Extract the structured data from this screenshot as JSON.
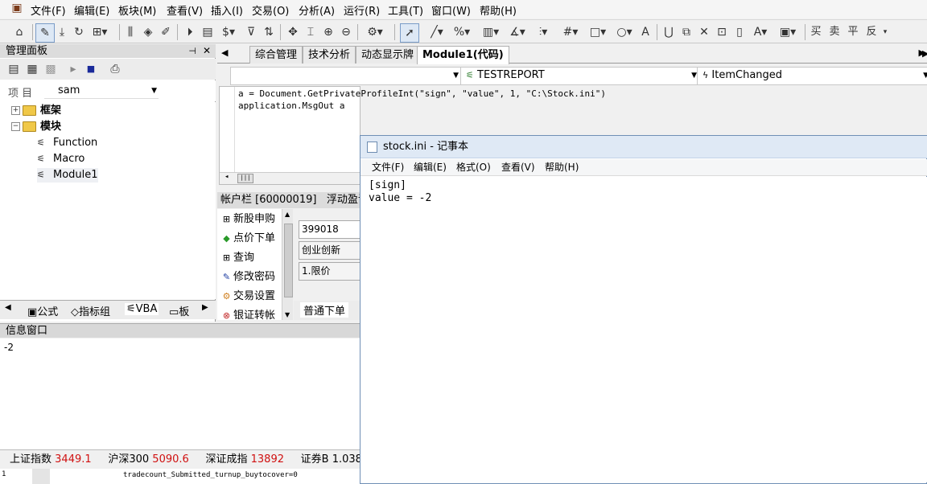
{
  "menu": [
    "文件(F)",
    "编辑(E)",
    "板块(M)",
    "查看(V)",
    "插入(I)",
    "交易(O)",
    "分析(A)",
    "运行(R)",
    "工具(T)",
    "窗口(W)",
    "帮助(H)"
  ],
  "toolbar_right": [
    "买",
    "卖",
    "平",
    "反"
  ],
  "left_panel": {
    "title": "管理面板",
    "combo_label": "项 目",
    "combo_value": "sam",
    "tree": {
      "framework": "框架",
      "modules": "模块",
      "children": [
        "Function",
        "Macro",
        "Module1"
      ]
    },
    "tabs": [
      "公式",
      "指标组",
      "VBA",
      "板"
    ]
  },
  "info": {
    "title": "信息窗口",
    "output": "-2",
    "status": [
      {
        "name": "上证指数",
        "value": "3449.1"
      },
      {
        "name": "沪深300",
        "value": "5090.6"
      },
      {
        "name": "深证成指",
        "value": "13892"
      },
      {
        "name": "证券B",
        "value": "1.038"
      }
    ],
    "bottom_left": "1",
    "bottom_code": "tradecount_Submitted_turnup_buytocover=0"
  },
  "doc_tabs": [
    "综合管理",
    "技术分析",
    "动态显示牌",
    "Module1(代码)"
  ],
  "editor": {
    "object_combo": "TESTREPORT",
    "event_combo": "ItemChanged",
    "code_line1_pre": "a = Document.GetPrivateProfileInt(",
    "code_line1_s1": "\"sign\"",
    "code_line1_mid": ", ",
    "code_line1_s2": "\"value\"",
    "code_line1_mid2": ", 1, ",
    "code_line1_s3": "\"C:\\Stock.ini\"",
    "code_line1_post": ")",
    "code_line2": "application.MsgOut a"
  },
  "account": {
    "title": "帐户栏 [60000019]",
    "title_more": "浮动盈亏",
    "menu": [
      "新股申购",
      "点价下单",
      "查询",
      "修改密码",
      "交易设置",
      "银证转帐"
    ],
    "code": "399018",
    "name": "创业创新",
    "price_type": "1.限价",
    "tab": "普通下单"
  },
  "notepad": {
    "title": "stock.ini - 记事本",
    "menu": [
      "文件(F)",
      "编辑(E)",
      "格式(O)",
      "查看(V)",
      "帮助(H)"
    ],
    "content": "[sign]\nvalue = -2"
  }
}
